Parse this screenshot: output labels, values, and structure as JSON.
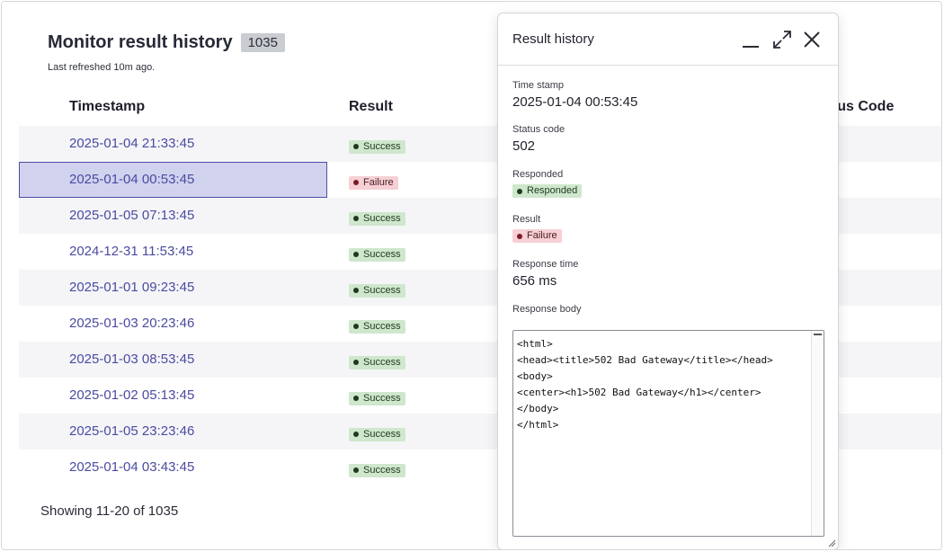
{
  "header": {
    "title": "Monitor result history",
    "count": "1035",
    "refreshed": "Last refreshed 10m ago."
  },
  "table": {
    "columns": {
      "timestamp": "Timestamp",
      "result": "Result",
      "status_code": "Status Code"
    },
    "rows": [
      {
        "timestamp": "2025-01-04 21:33:45",
        "result": "Success"
      },
      {
        "timestamp": "2025-01-04 00:53:45",
        "result": "Failure"
      },
      {
        "timestamp": "2025-01-05 07:13:45",
        "result": "Success"
      },
      {
        "timestamp": "2024-12-31 11:53:45",
        "result": "Success"
      },
      {
        "timestamp": "2025-01-01 09:23:45",
        "result": "Success"
      },
      {
        "timestamp": "2025-01-03 20:23:46",
        "result": "Success"
      },
      {
        "timestamp": "2025-01-03 08:53:45",
        "result": "Success"
      },
      {
        "timestamp": "2025-01-02 05:13:45",
        "result": "Success"
      },
      {
        "timestamp": "2025-01-05 23:23:46",
        "result": "Success"
      },
      {
        "timestamp": "2025-01-04 03:43:45",
        "result": "Success"
      }
    ],
    "selected_index": 1
  },
  "pagination": {
    "showing": "Showing 11-20 of 1035"
  },
  "panel": {
    "title": "Result history",
    "fields": {
      "timestamp_label": "Time stamp",
      "timestamp_value": "2025-01-04 00:53:45",
      "status_label": "Status code",
      "status_value": "502",
      "responded_label": "Responded",
      "responded_value": "Responded",
      "result_label": "Result",
      "result_value": "Failure",
      "response_time_label": "Response time",
      "response_time_value": "656 ms",
      "response_body_label": "Response body",
      "response_body": "<html>\n<head><title>502 Bad Gateway</title></head>\n<body>\n<center><h1>502 Bad Gateway</h1></center>\n</body>\n</html>"
    }
  },
  "icons": {
    "minimize": "minimize-icon",
    "expand": "expand-icon",
    "close": "close-icon",
    "resize": "resize-handle-icon"
  },
  "colors": {
    "link": "#4a4ba0",
    "success_bg": "#cfe7cd",
    "failure_bg": "#f6d0d4",
    "selected_bg": "#d1d2ee",
    "selected_border": "#4c4fa6"
  }
}
